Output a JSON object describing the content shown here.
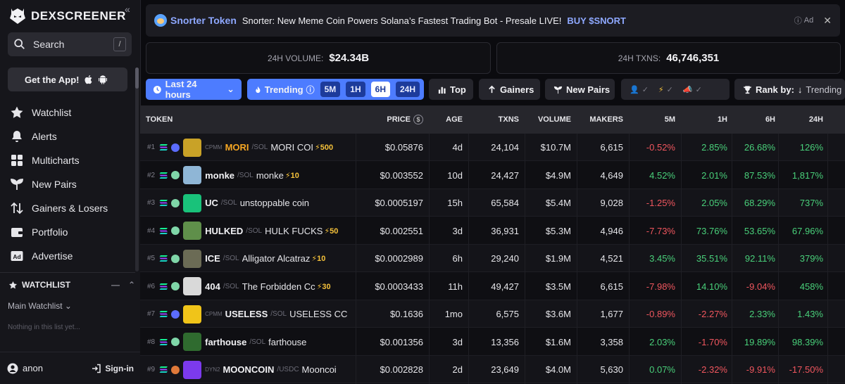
{
  "sidebar": {
    "logo": "DEXSCREENER",
    "search_label": "Search",
    "search_shortcut": "/",
    "get_app_label": "Get the App!",
    "nav": [
      {
        "label": "Watchlist",
        "icon": "star-icon"
      },
      {
        "label": "Alerts",
        "icon": "bell-icon"
      },
      {
        "label": "Multicharts",
        "icon": "grid-icon"
      },
      {
        "label": "New Pairs",
        "icon": "sprout-icon"
      },
      {
        "label": "Gainers & Losers",
        "icon": "arrows-updown-icon"
      },
      {
        "label": "Portfolio",
        "icon": "wallet-icon"
      },
      {
        "label": "Advertise",
        "icon": "ad-icon"
      }
    ],
    "watchlist_title": "WATCHLIST",
    "watchlist_select": "Main Watchlist",
    "watchlist_empty": "Nothing in this list yet...",
    "user": "anon",
    "signin": "Sign-in"
  },
  "ad": {
    "brand": "Snorter Token",
    "text": "Snorter: New Meme Coin Powers Solana’s Fastest Trading Bot - Presale LIVE!",
    "cta": "BUY $SNORT",
    "tag": "Ad"
  },
  "stats": {
    "volume_label": "24H VOLUME:",
    "volume_value": "$24.34B",
    "txns_label": "24H TXNS:",
    "txns_value": "46,746,351"
  },
  "toolbar": {
    "timeframe": "Last 24 hours",
    "trending": "Trending",
    "chips": [
      "5M",
      "1H",
      "6H",
      "24H"
    ],
    "active_chip": "6H",
    "top": "Top",
    "gainers": "Gainers",
    "new_pairs": "New Pairs",
    "rank_by": "Rank by:",
    "rank_value": "Trending"
  },
  "table": {
    "headers": {
      "token": "TOKEN",
      "price": "PRICE",
      "age": "AGE",
      "txns": "TXNS",
      "volume": "VOLUME",
      "makers": "MAKERS",
      "m5": "5M",
      "h1": "1H",
      "h6": "6H",
      "h24": "24H"
    },
    "rows": [
      {
        "rank": "#1",
        "dex": "CPMM",
        "symbol": "MORI",
        "quote": "/SOL",
        "name": "MORI COI",
        "boost": "⚡500",
        "price": "$0.05876",
        "age": "4d",
        "txns": "24,104",
        "volume": "$10.7M",
        "makers": "6,615",
        "m5": "-0.52%",
        "h1": "2.85%",
        "h6": "26.68%",
        "h24": "126%",
        "img": "#c9a227",
        "gold": true,
        "tag": "#5b6cff"
      },
      {
        "rank": "#2",
        "dex": "",
        "symbol": "monke",
        "quote": "/SOL",
        "name": "monke",
        "boost": "⚡10",
        "price": "$0.003552",
        "age": "10d",
        "txns": "24,427",
        "volume": "$4.9M",
        "makers": "4,649",
        "m5": "4.52%",
        "h1": "2.01%",
        "h6": "87.53%",
        "h24": "1,817%",
        "img": "#8fb6d6",
        "gold": false,
        "tag": "#7fd6a8"
      },
      {
        "rank": "#3",
        "dex": "",
        "symbol": "UC",
        "quote": "/SOL",
        "name": "unstoppable coin",
        "boost": "",
        "price": "$0.0005197",
        "age": "15h",
        "txns": "65,584",
        "volume": "$5.4M",
        "makers": "9,028",
        "m5": "-1.25%",
        "h1": "2.05%",
        "h6": "68.29%",
        "h24": "737%",
        "img": "#19c27a",
        "gold": false,
        "tag": "#7fd6a8"
      },
      {
        "rank": "#4",
        "dex": "",
        "symbol": "HULKED",
        "quote": "/SOL",
        "name": "HULK FUCKS",
        "boost": "⚡50",
        "price": "$0.002551",
        "age": "3d",
        "txns": "36,931",
        "volume": "$5.3M",
        "makers": "4,946",
        "m5": "-7.73%",
        "h1": "73.76%",
        "h6": "53.65%",
        "h24": "67.96%",
        "img": "#5f8f4a",
        "gold": false,
        "tag": "#7fd6a8"
      },
      {
        "rank": "#5",
        "dex": "",
        "symbol": "ICE",
        "quote": "/SOL",
        "name": "Alligator Alcatraz",
        "boost": "⚡10",
        "price": "$0.0002989",
        "age": "6h",
        "txns": "29,240",
        "volume": "$1.9M",
        "makers": "4,521",
        "m5": "3.45%",
        "h1": "35.51%",
        "h6": "92.11%",
        "h24": "379%",
        "img": "#6b6b55",
        "gold": false,
        "tag": "#7fd6a8"
      },
      {
        "rank": "#6",
        "dex": "",
        "symbol": "404",
        "quote": "/SOL",
        "name": "The Forbidden Cc",
        "boost": "⚡30",
        "price": "$0.0003433",
        "age": "11h",
        "txns": "49,427",
        "volume": "$3.5M",
        "makers": "6,615",
        "m5": "-7.98%",
        "h1": "14.10%",
        "h6": "-9.04%",
        "h24": "458%",
        "img": "#d9d9d9",
        "gold": false,
        "tag": "#7fd6a8"
      },
      {
        "rank": "#7",
        "dex": "CPMM",
        "symbol": "USELESS",
        "quote": "/SOL",
        "name": "USELESS CC",
        "boost": "",
        "price": "$0.1636",
        "age": "1mo",
        "txns": "6,575",
        "volume": "$3.6M",
        "makers": "1,677",
        "m5": "-0.89%",
        "h1": "-2.27%",
        "h6": "2.33%",
        "h24": "1.43%",
        "img": "#f0c419",
        "gold": false,
        "tag": "#5b6cff"
      },
      {
        "rank": "#8",
        "dex": "",
        "symbol": "farthouse",
        "quote": "/SOL",
        "name": "farthouse",
        "boost": "",
        "price": "$0.001356",
        "age": "3d",
        "txns": "13,356",
        "volume": "$1.6M",
        "makers": "3,358",
        "m5": "2.03%",
        "h1": "-1.70%",
        "h6": "19.89%",
        "h24": "98.39%",
        "img": "#2f6b2f",
        "gold": false,
        "tag": "#7fd6a8"
      },
      {
        "rank": "#9",
        "dex": "DYN2",
        "symbol": "MOONCOIN",
        "quote": "/USDC",
        "name": "Mooncoi",
        "boost": "",
        "price": "$0.002828",
        "age": "2d",
        "txns": "23,649",
        "volume": "$4.0M",
        "makers": "5,630",
        "m5": "0.07%",
        "h1": "-2.32%",
        "h6": "-9.91%",
        "h24": "-17.50%",
        "img": "#7c3aed",
        "gold": false,
        "tag": "#e07a3a"
      }
    ]
  }
}
